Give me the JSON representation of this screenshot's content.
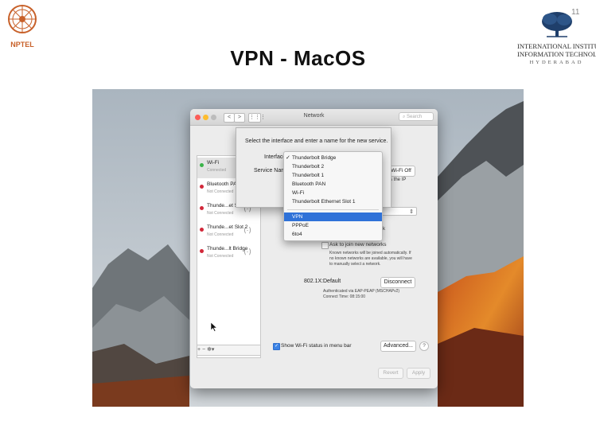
{
  "header": {
    "nptel_label": "NPTEL",
    "slide_title": "VPN - MacOS",
    "page_number": "11",
    "institute_line1": "INTERNATIONAL INSTITUTE",
    "institute_line2": "INFORMATION TECHNOLO",
    "institute_city": "HYDERABAD"
  },
  "window": {
    "title": "Network",
    "search_placeholder": "Search",
    "nav_back": "<",
    "nav_forward": ">",
    "grid_icon": "⋮⋮⋮"
  },
  "sidebar": {
    "items": [
      {
        "name": "Wi-Fi",
        "status": "Connected",
        "color": "#3bb44a"
      },
      {
        "name": "Bluetooth PAN",
        "status": "Not Connected",
        "color": "#d2283a"
      },
      {
        "name": "Thunde...et Slot 1",
        "status": "Not Connected",
        "color": "#d2283a"
      },
      {
        "name": "Thunde...et Slot 2",
        "status": "Not Connected",
        "color": "#d2283a"
      },
      {
        "name": "Thunde...lt Bridge",
        "status": "Not Connected",
        "color": "#d2283a"
      }
    ],
    "footer": "+ − ✻▾"
  },
  "detail": {
    "wifi_off_button": "Wi-Fi Off",
    "wifi_ip_text": "s the IP",
    "network_text": "network",
    "ask_to_join_label": "Ask to join new networks",
    "known_networks_text_1": "Known networks will be joined automatically. If",
    "known_networks_text_2": "no known networks are available, you will have",
    "known_networks_text_3": "to manually select a network.",
    "dot1x_label": "802.1X:",
    "dot1x_value": "Default",
    "disconnect_button": "Disconnect",
    "auth_text_1": "Authenticated via EAP-PEAP (MSCHAPv2)",
    "auth_text_2": "Connect Time: 08:15:00",
    "show_wifi_label": "Show Wi-Fi status in menu bar",
    "advanced_button": "Advanced...",
    "help_button": "?",
    "revert_button": "Revert",
    "apply_button": "Apply"
  },
  "sheet": {
    "prompt": "Select the interface and enter a name for the new service.",
    "interface_label": "Interface",
    "service_name_label": "Service Name"
  },
  "interface_menu": {
    "checkmark": "✓",
    "group1": [
      "Thunderbolt Bridge",
      "Thunderbolt 2",
      "Thunderbolt 1",
      "Bluetooth PAN",
      "Wi-Fi",
      "Thunderbolt Ethernet Slot 1"
    ],
    "group2": [
      "VPN",
      "PPPoE",
      "6to4"
    ],
    "selected": "VPN",
    "checked": "Thunderbolt Bridge"
  },
  "colors": {
    "accent": "#2f72d8",
    "status_connected": "#3bb44a",
    "status_not_connected": "#d2283a"
  }
}
